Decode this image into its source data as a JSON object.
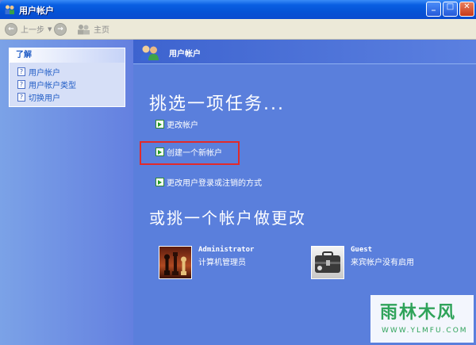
{
  "window": {
    "title": "用户帐户",
    "min_symbol": "_",
    "max_symbol": "□",
    "close_symbol": "✕"
  },
  "toolbar": {
    "back_label": "上一步",
    "home_label": "主页",
    "back_symbol": "←",
    "forward_symbol": "→",
    "dropdown_symbol": "▼"
  },
  "sidebar": {
    "title": "了解",
    "items": [
      {
        "label": "用户帐户"
      },
      {
        "label": "用户帐户类型"
      },
      {
        "label": "切换用户"
      }
    ],
    "icon_symbol": "?"
  },
  "main": {
    "header_title": "用户帐户",
    "pick_task_heading": "挑选一项任务...",
    "tasks": [
      {
        "label": "更改帐户"
      },
      {
        "label": "创建一个新帐户"
      },
      {
        "label": "更改用户登录或注销的方式"
      }
    ],
    "pick_account_heading": "或挑一个帐户做更改",
    "accounts": [
      {
        "name": "Administrator",
        "description": "计算机管理员"
      },
      {
        "name": "Guest",
        "description": "来宾帐户没有启用"
      }
    ]
  },
  "watermark": {
    "logo_text": "雨林木风",
    "url": "WWW.YLMFU.COM"
  },
  "colors": {
    "titlebar": "#0553d6",
    "left_pane": "#6f8fe2",
    "right_pane": "#5a7fdc",
    "highlight_border": "#e22a2a",
    "task_arrow": "#1f9a1f"
  }
}
